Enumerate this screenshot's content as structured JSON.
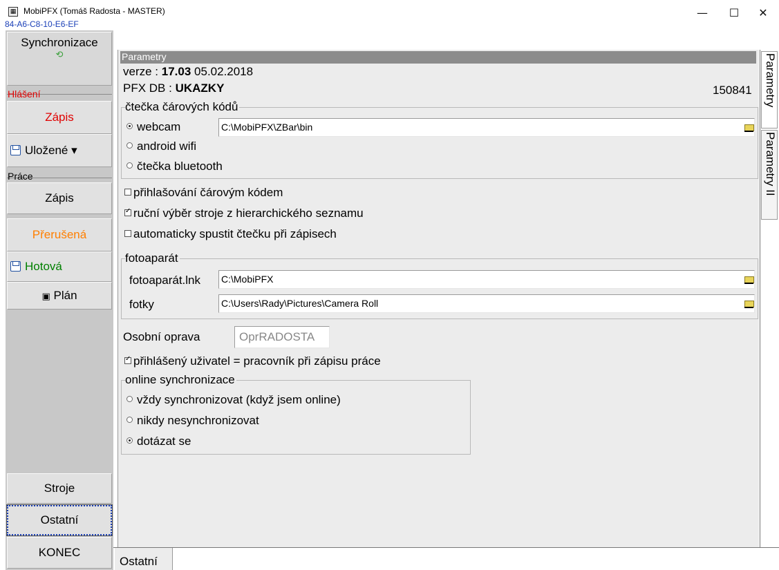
{
  "window": {
    "title": "MobiPFX (Tomáš Radosta - MASTER)",
    "minimize": "—",
    "maximize": "☐",
    "close": "✕",
    "mac": "84-A6-C8-10-E6-EF"
  },
  "nav": {
    "sync": "Synchronizace",
    "hlaseni_label": "Hlášení",
    "hlaseni_zapis": "Zápis",
    "ulozene": "Uložené ▾",
    "prace_label": "Práce",
    "prace_zapis": "Zápis",
    "prerusena": "Přerušená",
    "hotova": "Hotová",
    "plan": "Plán",
    "stroje": "Stroje",
    "ostatni": "Ostatní",
    "konec": "KONEC",
    "colors": {
      "red": "#e00000",
      "orange": "#ff7f00",
      "green": "#008000",
      "blue": "#1a3fb7"
    }
  },
  "params": {
    "header": "Parametry",
    "verze_label": "verze :",
    "verze_value": "17.03",
    "verze_date": "05.02.2018",
    "db_label": "PFX DB :",
    "db_value": "UKAZKY",
    "id": "150841",
    "reader_group": "čtečka čárových kódů",
    "opt_webcam": "webcam",
    "webcam_path": "C:\\MobiPFX\\ZBar\\bin",
    "opt_android": "android wifi",
    "opt_bt": "čtečka bluetooth",
    "chk_barcode_login": "přihlašování čárovým kódem",
    "chk_manual_select": "ruční výběr stroje z hierarchického seznamu",
    "chk_auto_reader": "automaticky spustit čtečku při zápisech",
    "camera_group": "fotoaparát",
    "camera_lnk_label": "fotoaparát.lnk",
    "camera_lnk_value": "C:\\MobiPFX",
    "photos_label": "fotky",
    "photos_value": "C:\\Users\\Rady\\Pictures\\Camera Roll",
    "personal_label": "Osobní oprava",
    "personal_value": "OprRADOSTA",
    "chk_user_worker": "přihlášený uživatel = pracovník při zápisu práce",
    "sync_group": "online synchronizace",
    "sync_always": "vždy synchronizovat (když jsem online)",
    "sync_never": "nikdy nesynchronizovat",
    "sync_ask": "dotázat se"
  },
  "tabs": {
    "right1": "Parametry",
    "right2": "Parametry II",
    "bottom": "Ostatní"
  }
}
